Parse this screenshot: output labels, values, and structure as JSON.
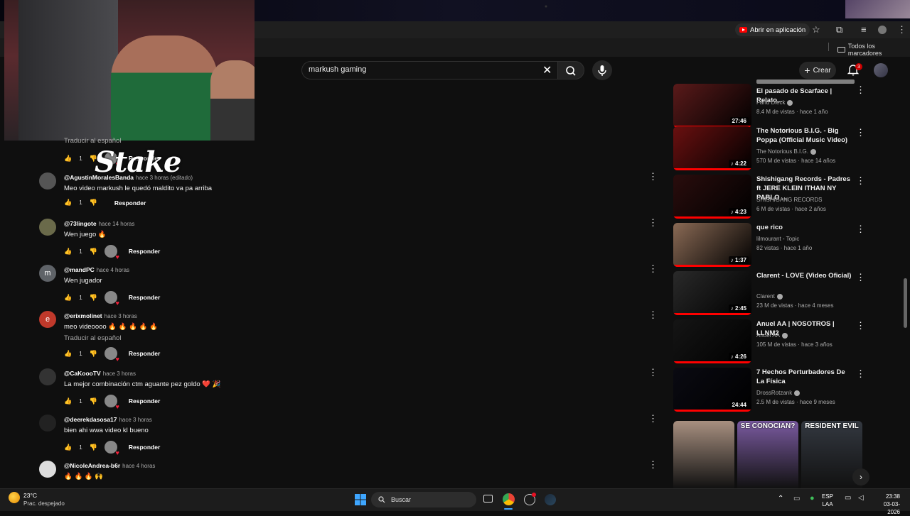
{
  "browser": {
    "open_in_app_label": "Abrir en aplicación",
    "all_bookmarks_label": "Todos los marcadores"
  },
  "header": {
    "search_value": "markush gaming",
    "create_label": "Crear",
    "notification_count": "3"
  },
  "overlay": {
    "brand": "Stake"
  },
  "comments": [
    {
      "author": "",
      "time": "",
      "text": "",
      "translate": "Traducir al español",
      "likes": "1",
      "reply": "Responder",
      "heart": true
    },
    {
      "author": "@AgustinMoralesBanda",
      "time": "hace 3 horas (editado)",
      "text": "Meo video markush le quedó maldito va pa arriba",
      "translate": "",
      "likes": "1",
      "reply": "Responder",
      "heart": false,
      "avatar": "#555"
    },
    {
      "author": "@73lingote",
      "time": "hace 14 horas",
      "text": "Wen juego 🔥",
      "translate": "",
      "likes": "1",
      "reply": "Responder",
      "heart": true,
      "avatar": "#6a6a4a"
    },
    {
      "author": "@mandPC",
      "time": "hace 4 horas",
      "text": "Wen jugador",
      "translate": "",
      "likes": "1",
      "reply": "Responder",
      "heart": true,
      "avatar": "#5f6368",
      "letter": "m"
    },
    {
      "author": "@erixmolinet",
      "time": "hace 3 horas",
      "text": "meo videoooo 🔥 🔥 🔥 🔥 🔥",
      "translate": "Traducir al español",
      "likes": "1",
      "reply": "Responder",
      "heart": true,
      "avatar": "#c0392b",
      "letter": "e"
    },
    {
      "author": "@CaKoooTV",
      "time": "hace 3 horas",
      "text": "La mejor combinación ctm aguante pez goldo ❤️ 🎉",
      "translate": "",
      "likes": "1",
      "reply": "Responder",
      "heart": true,
      "avatar": "#333"
    },
    {
      "author": "@deerekdasosa17",
      "time": "hace 3 horas",
      "text": "bien ahi wwa video kl bueno",
      "translate": "",
      "likes": "1",
      "reply": "Responder",
      "heart": true,
      "avatar": "#222"
    },
    {
      "author": "@NicoleAndrea-b6r",
      "time": "hace 4 horas",
      "text": "🔥 🔥 🔥 🙌",
      "translate": "",
      "likes": "",
      "reply": "",
      "heart": false,
      "avatar": "#ddd"
    }
  ],
  "sidebar_videos": [
    {
      "title": "El pasado de Scarface | Relato...",
      "channel": "Farid Dieck",
      "verified": true,
      "views": "8.4 M de vistas",
      "age": "hace 1 año",
      "duration": "27:46",
      "music": false,
      "thumb": "#5a1a1a"
    },
    {
      "title": "The Notorious B.I.G. - Big Poppa (Official Music Video)",
      "channel": "The Notorious B.I.G.",
      "verified": true,
      "views": "570 M de vistas",
      "age": "hace 14 años",
      "duration": "4:22",
      "music": true,
      "thumb": "#6a1010"
    },
    {
      "title": "Shishigang Records - Padres ft JERE KLEIN ITHAN NY PABLO ...",
      "channel": "SHISHIGANG RECORDS",
      "verified": false,
      "views": "6 M de vistas",
      "age": "hace 2 años",
      "duration": "4:23",
      "music": true,
      "thumb": "#2a0d0d"
    },
    {
      "title": "que rico",
      "channel": "lilmourant - Topic",
      "verified": false,
      "views": "82 vistas",
      "age": "hace 1 año",
      "duration": "1:37",
      "music": true,
      "thumb": "#8a6a55"
    },
    {
      "title": "Clarent - LOVE (Video Oficial)",
      "channel": "Clarent",
      "verified": true,
      "views": "23 M de vistas",
      "age": "hace 4 meses",
      "duration": "2:45",
      "music": true,
      "thumb": "#2a2a2a"
    },
    {
      "title": "Anuel AA | NOSOTROS | LLNM2",
      "channel": "Anuel AA",
      "verified": true,
      "views": "105 M de vistas",
      "age": "hace 3 años",
      "duration": "4:26",
      "music": true,
      "thumb": "#151515"
    },
    {
      "title": "7 Hechos Perturbadores De La Física",
      "channel": "DrossRotzank",
      "verified": true,
      "views": "2.5 M de vistas",
      "age": "hace 9 meses",
      "duration": "24:44",
      "music": false,
      "thumb": "#0a0a12"
    }
  ],
  "shorts": [
    {
      "caption": "",
      "thumb": "#a89080"
    },
    {
      "caption": "SE CONOCIAN?",
      "thumb": "#7a5aa0"
    },
    {
      "caption": "RESIDENT EVIL",
      "thumb": "#333840"
    }
  ],
  "taskbar": {
    "temperature": "23°C",
    "weather": "Prac. despejado",
    "search_label": "Buscar",
    "language": "ESP",
    "layout": "LAA",
    "time": "23:38",
    "date": "03-03-2026"
  }
}
